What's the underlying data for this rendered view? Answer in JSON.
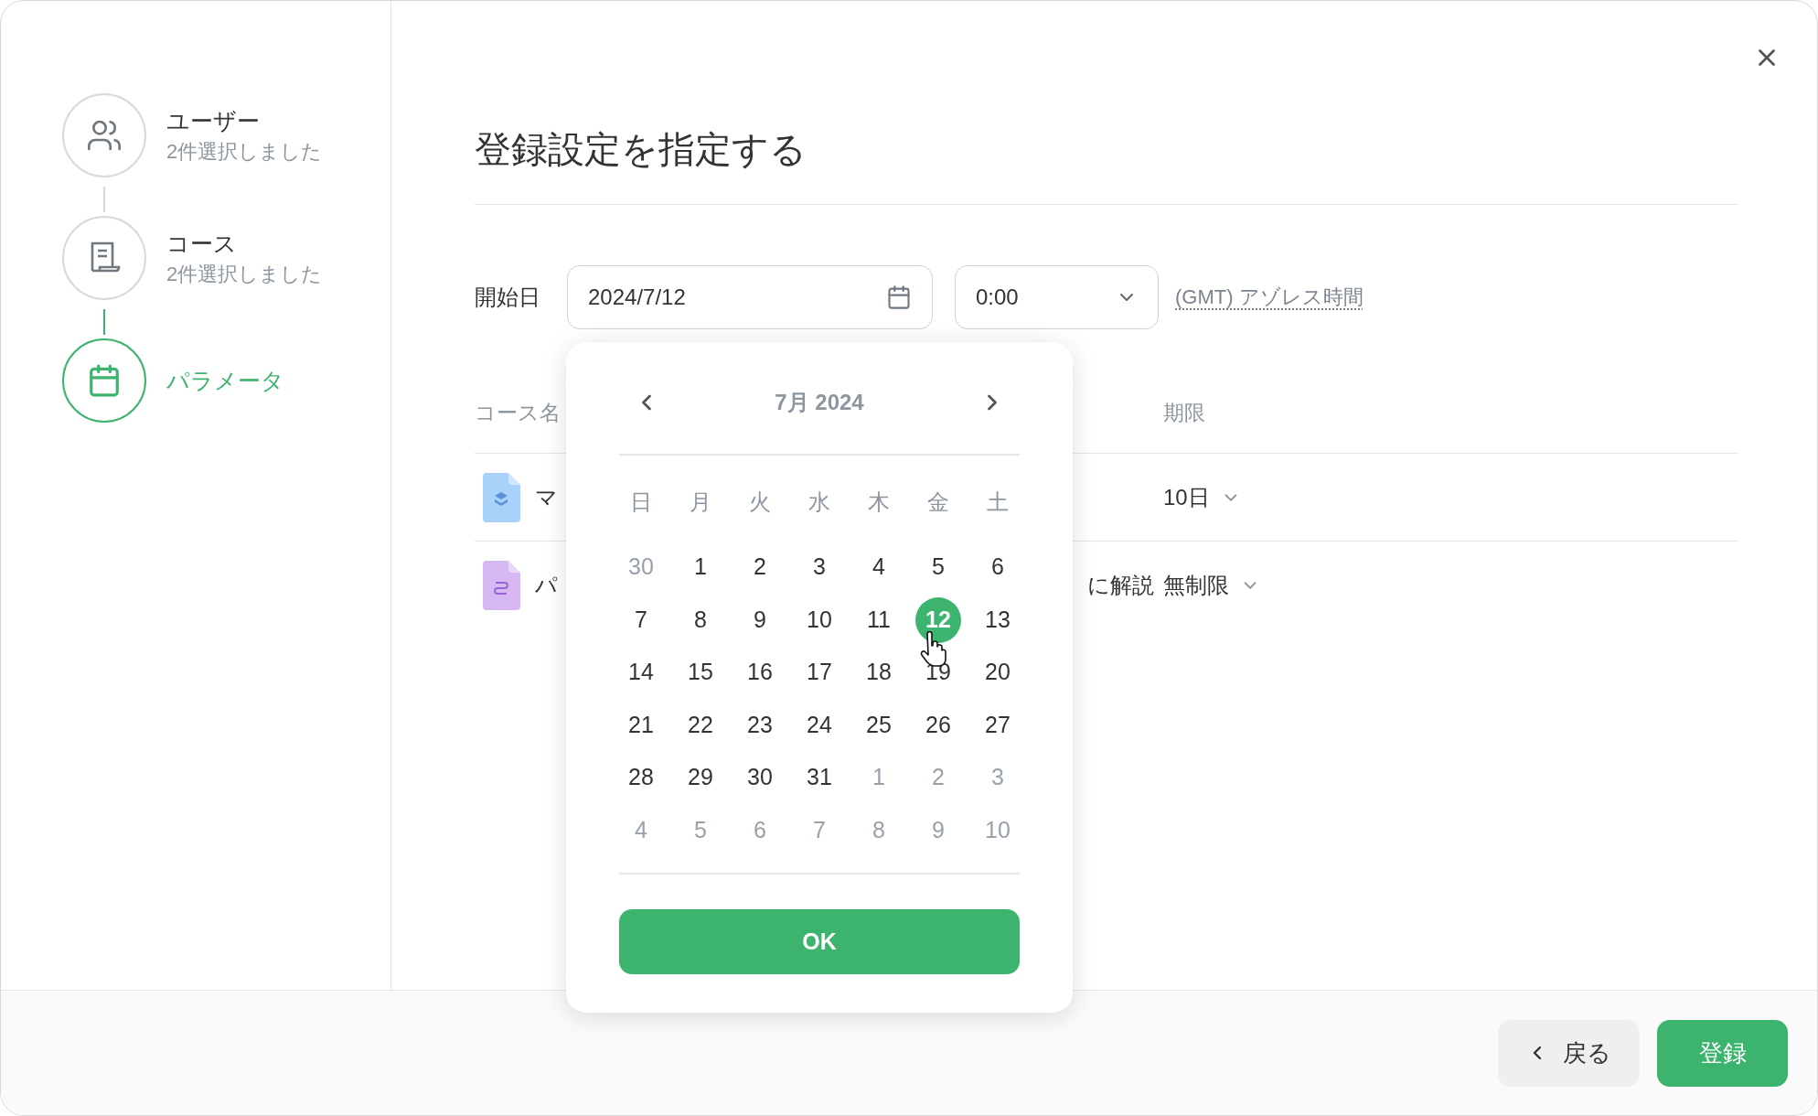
{
  "steps": [
    {
      "title": "ユーザー",
      "subtitle": "2件選択しました",
      "active": false
    },
    {
      "title": "コース",
      "subtitle": "2件選択しました",
      "active": false
    },
    {
      "title": "パラメータ",
      "active": true
    }
  ],
  "title": "登録設定を指定する",
  "start": {
    "label": "開始日",
    "date": "2024/7/12",
    "time": "0:00",
    "timezone": "(GMT) アゾレス時間"
  },
  "table": {
    "columns": [
      "コース名",
      "期限"
    ],
    "rows": [
      {
        "name": "マ",
        "color": "#a9d2fb",
        "deadline": "10日"
      },
      {
        "name": "パ",
        "name_tail": "に解説",
        "color": "#d6b8f2",
        "deadline": "無制限"
      }
    ]
  },
  "calendar": {
    "month": "7月 2024",
    "weekdays": [
      "日",
      "月",
      "火",
      "水",
      "木",
      "金",
      "土"
    ],
    "weeks": [
      [
        {
          "day": "30",
          "muted": true,
          "selected": false
        },
        {
          "day": "1",
          "muted": false,
          "selected": false
        },
        {
          "day": "2",
          "muted": false,
          "selected": false
        },
        {
          "day": "3",
          "muted": false,
          "selected": false
        },
        {
          "day": "4",
          "muted": false,
          "selected": false
        },
        {
          "day": "5",
          "muted": false,
          "selected": false
        },
        {
          "day": "6",
          "muted": false,
          "selected": false
        }
      ],
      [
        {
          "day": "7",
          "muted": false,
          "selected": false
        },
        {
          "day": "8",
          "muted": false,
          "selected": false
        },
        {
          "day": "9",
          "muted": false,
          "selected": false
        },
        {
          "day": "10",
          "muted": false,
          "selected": false
        },
        {
          "day": "11",
          "muted": false,
          "selected": false
        },
        {
          "day": "12",
          "muted": false,
          "selected": true
        },
        {
          "day": "13",
          "muted": false,
          "selected": false
        }
      ],
      [
        {
          "day": "14",
          "muted": false,
          "selected": false
        },
        {
          "day": "15",
          "muted": false,
          "selected": false
        },
        {
          "day": "16",
          "muted": false,
          "selected": false
        },
        {
          "day": "17",
          "muted": false,
          "selected": false
        },
        {
          "day": "18",
          "muted": false,
          "selected": false
        },
        {
          "day": "19",
          "muted": false,
          "selected": false
        },
        {
          "day": "20",
          "muted": false,
          "selected": false
        }
      ],
      [
        {
          "day": "21",
          "muted": false,
          "selected": false
        },
        {
          "day": "22",
          "muted": false,
          "selected": false
        },
        {
          "day": "23",
          "muted": false,
          "selected": false
        },
        {
          "day": "24",
          "muted": false,
          "selected": false
        },
        {
          "day": "25",
          "muted": false,
          "selected": false
        },
        {
          "day": "26",
          "muted": false,
          "selected": false
        },
        {
          "day": "27",
          "muted": false,
          "selected": false
        }
      ],
      [
        {
          "day": "28",
          "muted": false,
          "selected": false
        },
        {
          "day": "29",
          "muted": false,
          "selected": false
        },
        {
          "day": "30",
          "muted": false,
          "selected": false
        },
        {
          "day": "31",
          "muted": false,
          "selected": false
        },
        {
          "day": "1",
          "muted": true,
          "selected": false
        },
        {
          "day": "2",
          "muted": true,
          "selected": false
        },
        {
          "day": "3",
          "muted": true,
          "selected": false
        }
      ],
      [
        {
          "day": "4",
          "muted": true,
          "selected": false
        },
        {
          "day": "5",
          "muted": true,
          "selected": false
        },
        {
          "day": "6",
          "muted": true,
          "selected": false
        },
        {
          "day": "7",
          "muted": true,
          "selected": false
        },
        {
          "day": "8",
          "muted": true,
          "selected": false
        },
        {
          "day": "9",
          "muted": true,
          "selected": false
        },
        {
          "day": "10",
          "muted": true,
          "selected": false
        }
      ]
    ],
    "ok": "OK"
  },
  "footer": {
    "back": "戻る",
    "submit": "登録"
  }
}
